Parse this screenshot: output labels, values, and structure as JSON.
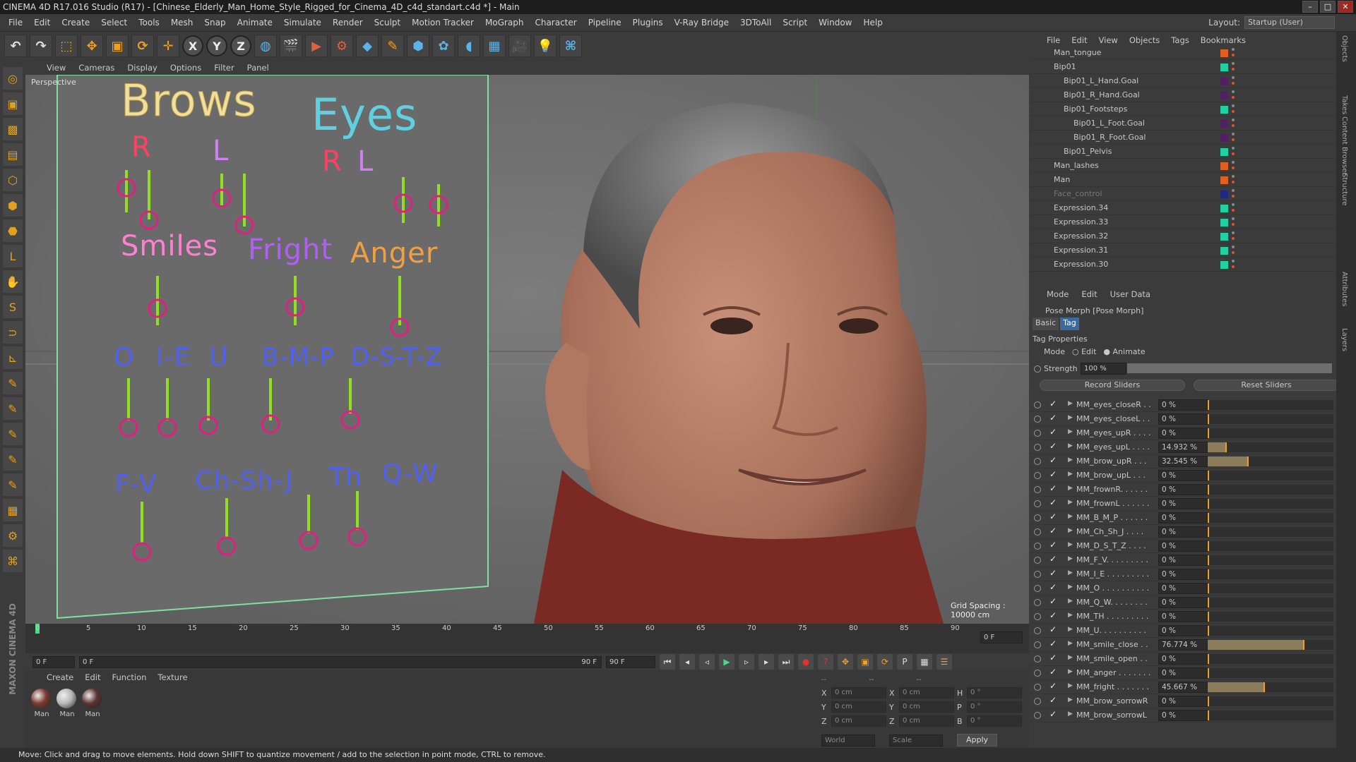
{
  "title": "CINEMA 4D R17.016 Studio (R17) - [Chinese_Elderly_Man_Home_Style_Rigged_for_Cinema_4D_c4d_standart.c4d *] - Main",
  "menu": [
    "File",
    "Edit",
    "Create",
    "Select",
    "Tools",
    "Mesh",
    "Snap",
    "Animate",
    "Simulate",
    "Render",
    "Sculpt",
    "Motion Tracker",
    "MoGraph",
    "Character",
    "Pipeline",
    "Plugins",
    "V-Ray Bridge",
    "3DToAll",
    "Script",
    "Window",
    "Help"
  ],
  "layout": {
    "label": "Layout:",
    "value": "Startup (User)"
  },
  "toolbar": {
    "x": "X",
    "y": "Y",
    "z": "Z"
  },
  "viewport": {
    "menu": [
      "View",
      "Cameras",
      "Display",
      "Options",
      "Filter",
      "Panel"
    ],
    "label": "Perspective",
    "grid_spacing": "Grid Spacing : 10000 cm"
  },
  "face_rig": {
    "brows": "Brows",
    "eyes": "Eyes",
    "r1": "R",
    "l1": "L",
    "r2": "R",
    "l2": "L",
    "smiles": "Smiles",
    "fright": "Fright",
    "anger": "Anger",
    "o": "O",
    "ie": "I-E",
    "u": "U",
    "bmp": "B-M-P",
    "dstz": "D-S-T-Z",
    "fv": "F-V",
    "chshj": "Ch-Sh-J",
    "th": "Th",
    "qw": "Q-W"
  },
  "timeline": {
    "ticks": [
      "0",
      "5",
      "10",
      "15",
      "20",
      "25",
      "30",
      "35",
      "40",
      "45",
      "50",
      "55",
      "60",
      "65",
      "70",
      "75",
      "80",
      "85",
      "90"
    ],
    "frame_right": "0 F",
    "start": "0 F",
    "range_start": "0 F",
    "range_end": "90 F",
    "end": "90 F"
  },
  "materials": {
    "menu": [
      "Create",
      "Edit",
      "Function",
      "Texture"
    ],
    "items": [
      {
        "label": "Man",
        "color": "#7a3a30"
      },
      {
        "label": "Man",
        "color": "#b8b8b8"
      },
      {
        "label": "Man",
        "color": "#5a3430"
      }
    ]
  },
  "coords": {
    "header_left": "--",
    "header_mid": "--",
    "header_right": "--",
    "rows": [
      {
        "a": "X",
        "av": "0 cm",
        "b": "X",
        "bv": "0 cm",
        "c": "H",
        "cv": "0 °"
      },
      {
        "a": "Y",
        "av": "0 cm",
        "b": "Y",
        "bv": "0 cm",
        "c": "P",
        "cv": "0 °"
      },
      {
        "a": "Z",
        "av": "0 cm",
        "b": "Z",
        "bv": "0 cm",
        "c": "B",
        "cv": "0 °"
      }
    ],
    "world": "World",
    "scale": "Scale",
    "apply": "Apply"
  },
  "objects": {
    "menu": [
      "File",
      "Edit",
      "View",
      "Objects",
      "Tags",
      "Bookmarks"
    ],
    "rows": [
      {
        "name": "Man_tongue",
        "indent": 1,
        "color": "#e06020"
      },
      {
        "name": "Bip01",
        "indent": 1,
        "color": "#20d0a0"
      },
      {
        "name": "Bip01_L_Hand.Goal",
        "indent": 2,
        "color": "#502060"
      },
      {
        "name": "Bip01_R_Hand.Goal",
        "indent": 2,
        "color": "#502060"
      },
      {
        "name": "Bip01_Footsteps",
        "indent": 2,
        "color": "#20d0a0"
      },
      {
        "name": "Bip01_L_Foot.Goal",
        "indent": 3,
        "color": "#502060"
      },
      {
        "name": "Bip01_R_Foot.Goal",
        "indent": 3,
        "color": "#502060"
      },
      {
        "name": "Bip01_Pelvis",
        "indent": 2,
        "color": "#20d0a0"
      },
      {
        "name": "Man_lashes",
        "indent": 1,
        "color": "#e06020"
      },
      {
        "name": "Man",
        "indent": 1,
        "color": "#e06020"
      },
      {
        "name": "Face_control",
        "indent": 1,
        "color": "#202880",
        "dim": true
      },
      {
        "name": "Expression.34",
        "indent": 1,
        "color": "#20d0a0"
      },
      {
        "name": "Expression.33",
        "indent": 1,
        "color": "#20d0a0"
      },
      {
        "name": "Expression.32",
        "indent": 1,
        "color": "#20d0a0"
      },
      {
        "name": "Expression.31",
        "indent": 1,
        "color": "#20d0a0"
      },
      {
        "name": "Expression.30",
        "indent": 1,
        "color": "#20d0a0"
      }
    ]
  },
  "attributes": {
    "menu": [
      "Mode",
      "Edit",
      "User Data"
    ],
    "title": "Pose Morph [Pose Morph]",
    "tabs": [
      "Basic",
      "Tag"
    ],
    "section": "Tag Properties",
    "mode_label": "Mode",
    "mode_edit": "Edit",
    "mode_animate": "Animate",
    "strength_label": "Strength",
    "strength_value": "100 %",
    "strength_fraction": 1.0,
    "record": "Record Sliders",
    "reset": "Reset Sliders",
    "sliders": [
      {
        "name": "MM_eyes_closeR . .",
        "value": "0 %",
        "fraction": 0
      },
      {
        "name": "MM_eyes_closeL . .",
        "value": "0 %",
        "fraction": 0
      },
      {
        "name": "MM_eyes_upR . . . .",
        "value": "0 %",
        "fraction": 0
      },
      {
        "name": "MM_eyes_upL . . . .",
        "value": "14.932 %",
        "fraction": 0.14932
      },
      {
        "name": "MM_brow_upR . . .",
        "value": "32.545 %",
        "fraction": 0.32545
      },
      {
        "name": "MM_brow_upL . . .",
        "value": "0 %",
        "fraction": 0
      },
      {
        "name": "MM_frownR. . . . . .",
        "value": "0 %",
        "fraction": 0
      },
      {
        "name": "MM_frownL . . . . . .",
        "value": "0 %",
        "fraction": 0
      },
      {
        "name": "MM_B_M_P . . . . . .",
        "value": "0 %",
        "fraction": 0
      },
      {
        "name": "MM_Ch_Sh_J . . . .",
        "value": "0 %",
        "fraction": 0
      },
      {
        "name": "MM_D_S_T_Z . . . .",
        "value": "0 %",
        "fraction": 0
      },
      {
        "name": "MM_F_V. . . . . . . . .",
        "value": "0 %",
        "fraction": 0
      },
      {
        "name": "MM_I_E . . . . . . . . .",
        "value": "0 %",
        "fraction": 0
      },
      {
        "name": "MM_O . . . . . . . . . .",
        "value": "0 %",
        "fraction": 0
      },
      {
        "name": "MM_Q_W. . . . . . . .",
        "value": "0 %",
        "fraction": 0
      },
      {
        "name": "MM_TH . . . . . . . . .",
        "value": "0 %",
        "fraction": 0
      },
      {
        "name": "MM_U. . . . . . . . . .",
        "value": "0 %",
        "fraction": 0
      },
      {
        "name": "MM_smile_close . .",
        "value": "76.774 %",
        "fraction": 0.76774
      },
      {
        "name": "MM_smile_open . .",
        "value": "0 %",
        "fraction": 0
      },
      {
        "name": "MM_anger . . . . . . .",
        "value": "0 %",
        "fraction": 0
      },
      {
        "name": "MM_fright . . . . . . .",
        "value": "45.667 %",
        "fraction": 0.45667
      },
      {
        "name": "MM_brow_sorrowR",
        "value": "0 %",
        "fraction": 0
      },
      {
        "name": "MM_brow_sorrowL",
        "value": "0 %",
        "fraction": 0
      }
    ]
  },
  "side_tabs": [
    "Objects",
    "Takes",
    "Content Browser",
    "Structure",
    "Attributes",
    "Layers"
  ],
  "status": "Move: Click and drag to move elements. Hold down SHIFT to quantize movement / add to the selection in point mode, CTRL to remove.",
  "brand": "MAXON CINEMA 4D"
}
